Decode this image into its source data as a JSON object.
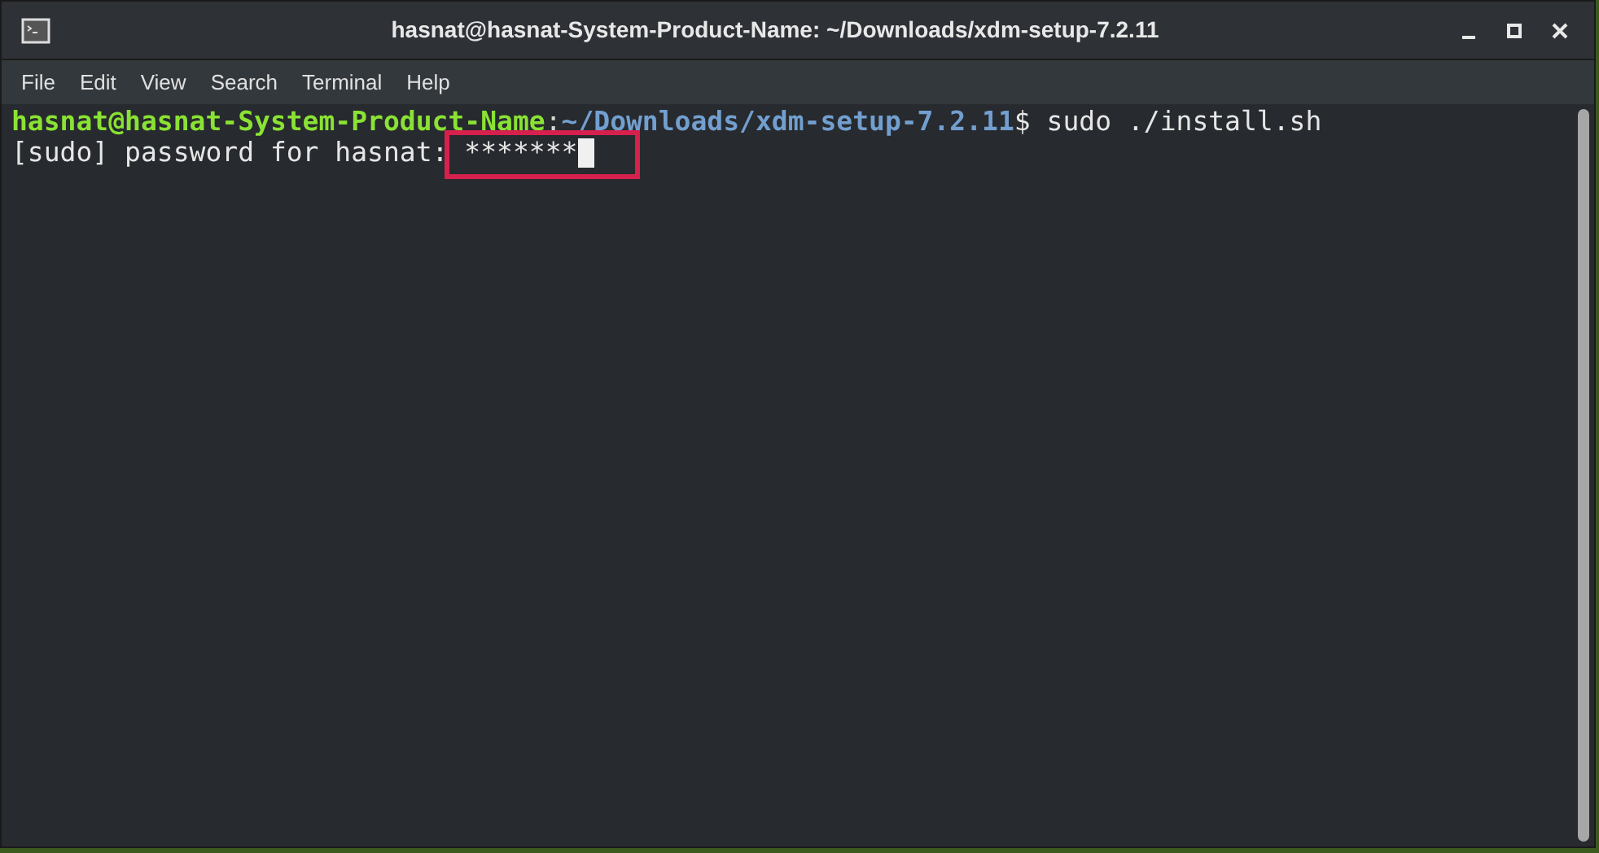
{
  "window": {
    "title": "hasnat@hasnat-System-Product-Name: ~/Downloads/xdm-setup-7.2.11"
  },
  "menu": [
    "File",
    "Edit",
    "View",
    "Search",
    "Terminal",
    "Help"
  ],
  "terminal": {
    "lines": [
      {
        "kind": "prompt",
        "user_host": "hasnat@hasnat-System-Product-Name",
        "separator": ":",
        "path": "~/Downloads/xdm-setup-7.2.11",
        "symbol": "$",
        "command": " sudo ./install.sh"
      },
      {
        "kind": "password",
        "prompt": "[sudo] password for hasnat: ",
        "input": "*******",
        "highlighted": true
      }
    ]
  }
}
